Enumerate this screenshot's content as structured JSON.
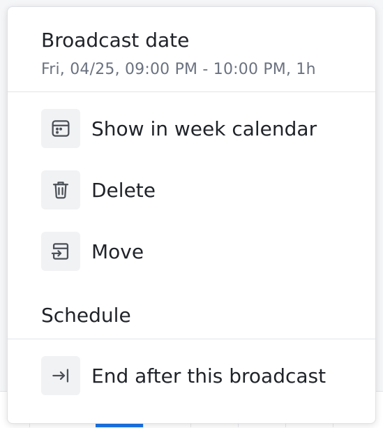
{
  "broadcast_date": {
    "title": "Broadcast date",
    "subtitle": "Fri, 04/25, 09:00 PM - 10:00 PM, 1h"
  },
  "actions": [
    {
      "label": "Show in week calendar",
      "icon": "calendar-icon"
    },
    {
      "label": "Delete",
      "icon": "trash-icon"
    },
    {
      "label": "Move",
      "icon": "move-icon"
    }
  ],
  "schedule": {
    "title": "Schedule",
    "items": [
      {
        "label": "End after this broadcast",
        "icon": "arrow-to-end-icon"
      }
    ]
  },
  "colors": {
    "accent": "#1a73e8",
    "text_primary": "#1f2329",
    "text_secondary": "#6b7280",
    "icon_bg": "#f1f2f4"
  }
}
